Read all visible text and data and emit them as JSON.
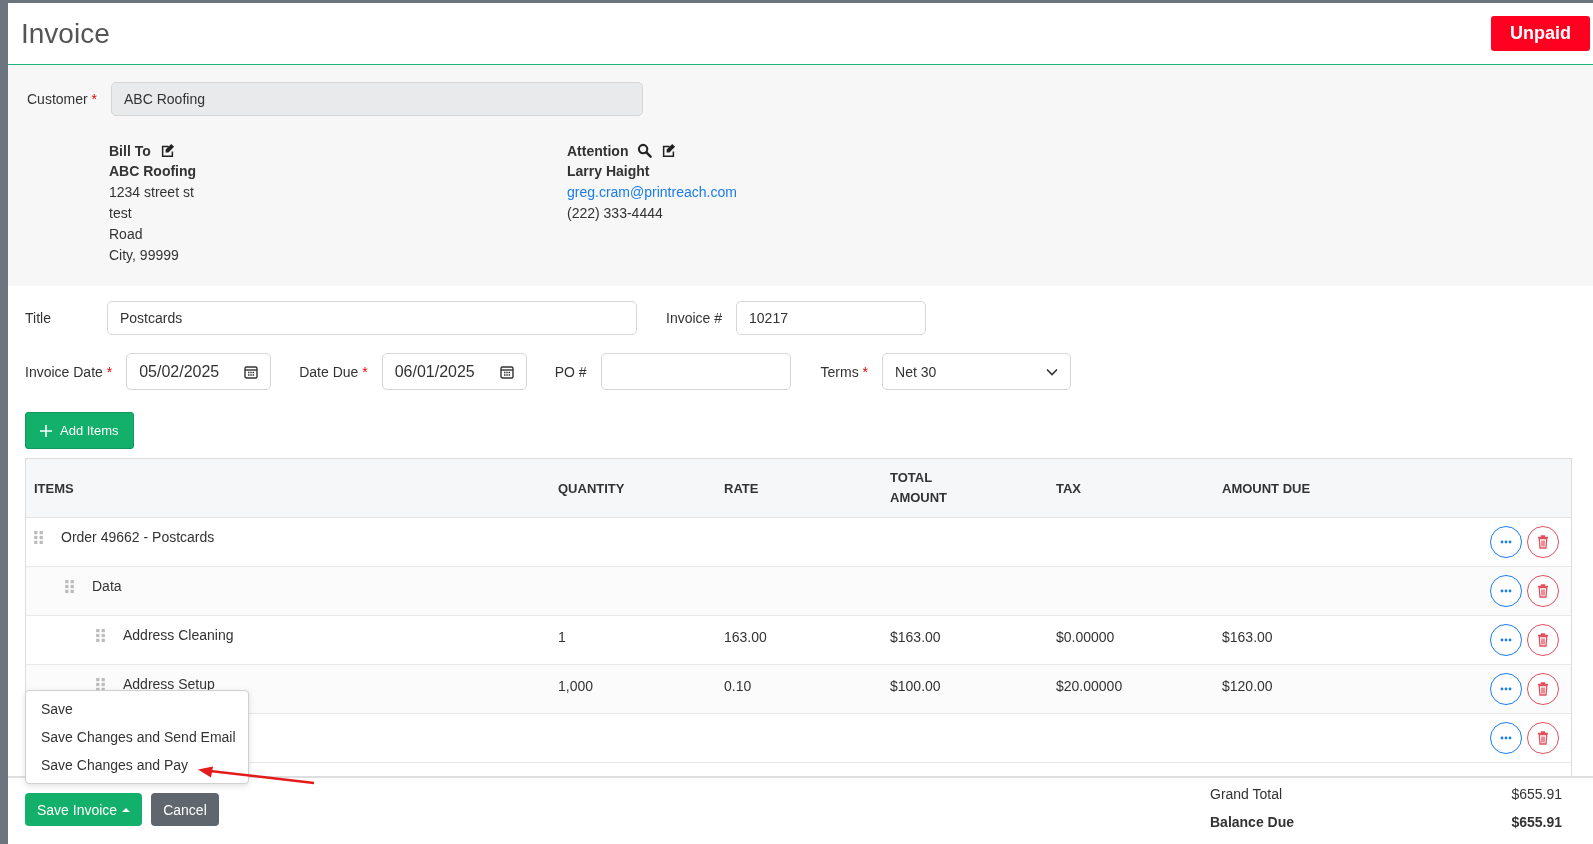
{
  "header": {
    "title": "Invoice",
    "status": "Unpaid"
  },
  "customer": {
    "label": "Customer",
    "required_mark": "*",
    "value": "ABC Roofing"
  },
  "bill_to": {
    "heading": "Bill To",
    "lines": [
      {
        "text": "ABC Roofing",
        "bold": true
      },
      {
        "text": "1234 street st",
        "bold": false
      },
      {
        "text": "test",
        "bold": false
      },
      {
        "text": "Road",
        "bold": false
      },
      {
        "text": "City, 99999",
        "bold": false
      }
    ]
  },
  "attention": {
    "heading": "Attention",
    "name": "Larry Haight",
    "email": "greg.cram@printreach.com",
    "phone": "(222) 333-4444"
  },
  "title_field": {
    "label": "Title",
    "value": "Postcards"
  },
  "invoice_number": {
    "label": "Invoice #",
    "value": "10217"
  },
  "invoice_date": {
    "label": "Invoice Date",
    "required_mark": "*",
    "value": "05/02/2025"
  },
  "date_due": {
    "label": "Date Due",
    "required_mark": "*",
    "value": "06/01/2025"
  },
  "po": {
    "label": "PO #"
  },
  "terms": {
    "label": "Terms",
    "required_mark": "*",
    "value": "Net 30"
  },
  "add_items": "Add Items",
  "table": {
    "columns": [
      "ITEMS",
      "QUANTITY",
      "RATE",
      "TOTAL AMOUNT",
      "TAX",
      "AMOUNT DUE"
    ],
    "rows": [
      {
        "name": "Order 49662 - Postcards",
        "children": [
          {
            "name": "Data",
            "children": [
              {
                "name": "Address Cleaning",
                "quantity": "1",
                "rate": "163.00",
                "total": "$163.00",
                "tax": "$0.00000",
                "amount_due": "$163.00"
              },
              {
                "name": "Address Setup",
                "quantity": "1,000",
                "rate": "0.10",
                "total": "$100.00",
                "tax": "$20.00000",
                "amount_due": "$120.00"
              }
            ]
          },
          {
            "covered": true
          }
        ]
      }
    ]
  },
  "save_menu": {
    "open": true,
    "items": [
      "Save",
      "Save Changes and Send Email",
      "Save Changes and Pay"
    ]
  },
  "footer": {
    "save": "Save Invoice",
    "cancel": "Cancel",
    "totals": [
      {
        "label": "Grand Total",
        "value": "$655.91",
        "bold": false
      },
      {
        "label": "Balance Due",
        "value": "$655.91",
        "bold": true
      }
    ]
  }
}
